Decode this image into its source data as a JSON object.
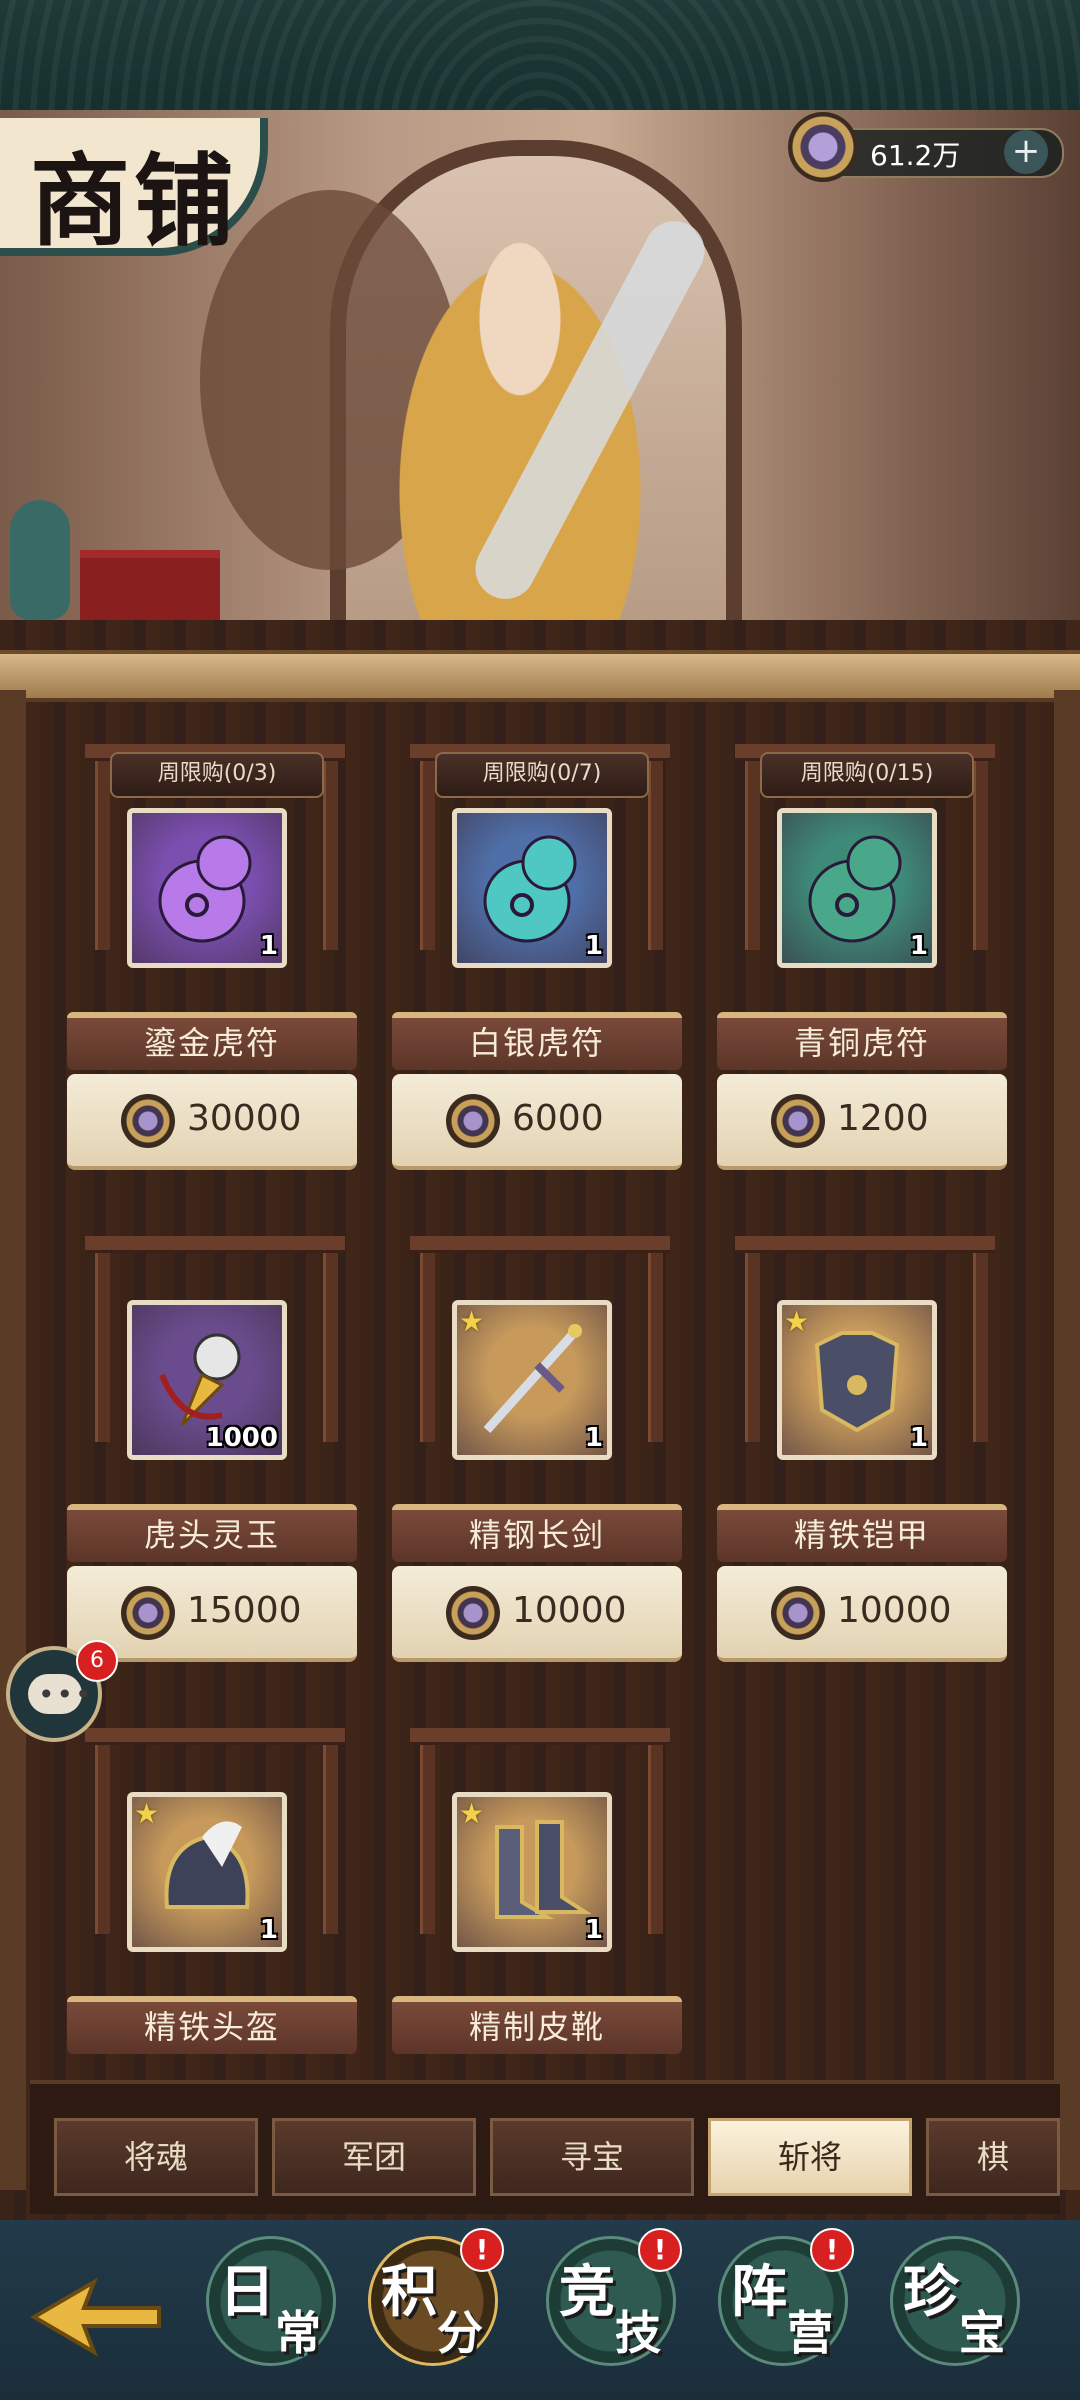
{
  "header": {
    "title": "商铺",
    "currency": {
      "value": "61.2万",
      "plus": "+"
    }
  },
  "items": [
    {
      "name": "鎏金虎符",
      "limit": "周限购(0/3)",
      "price": "30000",
      "qty": "1",
      "bg": "#7b4fb0",
      "icon": "purple-tiger-tally-icon"
    },
    {
      "name": "白银虎符",
      "limit": "周限购(0/7)",
      "price": "6000",
      "qty": "1",
      "bg": "#4f6fa8",
      "icon": "teal-tiger-tally-icon"
    },
    {
      "name": "青铜虎符",
      "limit": "周限购(0/15)",
      "price": "1200",
      "qty": "1",
      "bg": "#3e8a78",
      "icon": "green-tiger-tally-icon"
    },
    {
      "name": "虎头灵玉",
      "limit": "",
      "price": "15000",
      "qty": "1000",
      "bg": "#6a4c8e",
      "icon": "tiger-jade-icon"
    },
    {
      "name": "精钢长剑",
      "limit": "",
      "price": "10000",
      "qty": "1",
      "bg": "#c79a5c",
      "icon": "sword-icon"
    },
    {
      "name": "精铁铠甲",
      "limit": "",
      "price": "10000",
      "qty": "1",
      "bg": "#c79a5c",
      "icon": "armor-icon"
    },
    {
      "name": "精铁头盔",
      "limit": "",
      "price": "",
      "qty": "1",
      "bg": "#c79a5c",
      "icon": "helmet-icon"
    },
    {
      "name": "精制皮靴",
      "limit": "",
      "price": "",
      "qty": "1",
      "bg": "#c79a5c",
      "icon": "boots-icon"
    }
  ],
  "tabs": [
    {
      "label": "将魂"
    },
    {
      "label": "军团"
    },
    {
      "label": "寻宝"
    },
    {
      "label": "斩将",
      "active": true
    },
    {
      "label": "棋"
    }
  ],
  "nav": [
    {
      "big": "日",
      "small": "常"
    },
    {
      "big": "积",
      "small": "分",
      "active": true,
      "alert": "!"
    },
    {
      "big": "竞",
      "small": "技",
      "alert": "!"
    },
    {
      "big": "阵",
      "small": "营",
      "alert": "!"
    },
    {
      "big": "珍",
      "small": "宝"
    }
  ],
  "chat": {
    "badge": "6"
  }
}
